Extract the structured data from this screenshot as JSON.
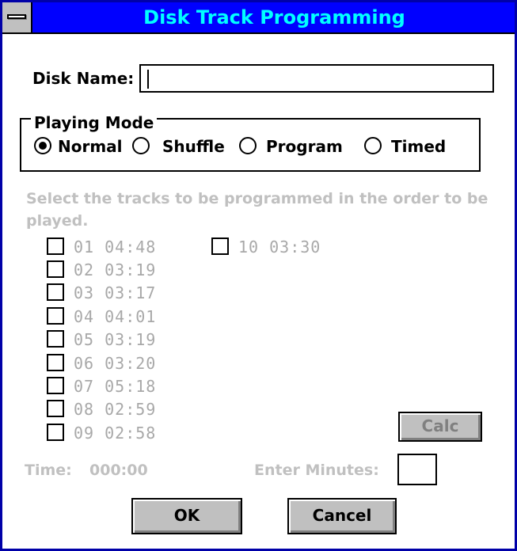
{
  "window": {
    "title": "Disk Track Programming"
  },
  "disk_name": {
    "label": "Disk Name:",
    "value": ""
  },
  "playing_mode": {
    "title": "Playing Mode",
    "options": [
      {
        "label": "Normal",
        "selected": true
      },
      {
        "label": "Shuffle",
        "selected": false
      },
      {
        "label": "Program",
        "selected": false
      },
      {
        "label": "Timed",
        "selected": false
      }
    ]
  },
  "instructions": "Select the tracks to be programmed in the order to be played.",
  "tracks": [
    {
      "label": "01 04:48",
      "checked": false
    },
    {
      "label": "02 03:19",
      "checked": false
    },
    {
      "label": "03 03:17",
      "checked": false
    },
    {
      "label": "04 04:01",
      "checked": false
    },
    {
      "label": "05 03:19",
      "checked": false
    },
    {
      "label": "06 03:20",
      "checked": false
    },
    {
      "label": "07 05:18",
      "checked": false
    },
    {
      "label": "08 02:59",
      "checked": false
    },
    {
      "label": "09 02:58",
      "checked": false
    },
    {
      "label": "10 03:30",
      "checked": false
    }
  ],
  "calc_button": "Calc",
  "time": {
    "label": "Time:",
    "value": "000:00"
  },
  "enter_minutes": {
    "label": "Enter Minutes:",
    "value": ""
  },
  "buttons": {
    "ok": "OK",
    "cancel": "Cancel"
  },
  "colors": {
    "title_bar": "#0000ff",
    "title_text": "#00ffff",
    "disabled_text": "#c0c0c0",
    "button_face": "#c0c0c0"
  }
}
